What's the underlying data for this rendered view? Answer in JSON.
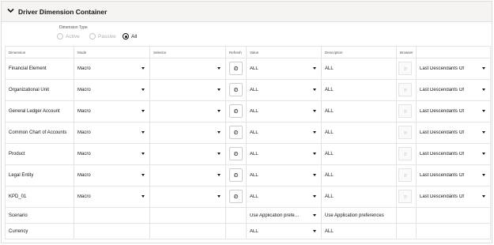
{
  "panel": {
    "title": "Driver Dimension Container"
  },
  "dimension_type": {
    "label": "Dimension Type",
    "options": [
      {
        "label": "Active",
        "selected": false
      },
      {
        "label": "Passive",
        "selected": false
      },
      {
        "label": "All",
        "selected": true
      }
    ]
  },
  "columns": {
    "dimension": "Dimension",
    "mode": "Mode",
    "selector": "Selector",
    "refresh": "Refresh",
    "value": "Value",
    "description": "Description",
    "browser": "Browser"
  },
  "rows": [
    {
      "dimension": "Financial Element",
      "mode": "Macro",
      "selector": "",
      "value": "ALL",
      "description": "ALL",
      "hierarchy": "Last Descendants Of"
    },
    {
      "dimension": "Organizational Unit",
      "mode": "Macro",
      "selector": "",
      "value": "ALL",
      "description": "ALL",
      "hierarchy": "Last Descendants Of"
    },
    {
      "dimension": "General Ledger Account",
      "mode": "Macro",
      "selector": "",
      "value": "ALL",
      "description": "ALL",
      "hierarchy": "Last Descendants Of"
    },
    {
      "dimension": "Common Chart of Accounts",
      "mode": "Macro",
      "selector": "",
      "value": "ALL",
      "description": "ALL",
      "hierarchy": "Last Descendants Of"
    },
    {
      "dimension": "Product",
      "mode": "Macro",
      "selector": "",
      "value": "ALL",
      "description": "ALL",
      "hierarchy": "Last Descendants Of"
    },
    {
      "dimension": "Legal Entity",
      "mode": "Macro",
      "selector": "",
      "value": "ALL",
      "description": "ALL",
      "hierarchy": "Last Descendants Of"
    },
    {
      "dimension": "KPD_01",
      "mode": "Macro",
      "selector": "",
      "value": "ALL",
      "description": "ALL",
      "hierarchy": "Last Descendants Of"
    }
  ],
  "extra_rows": [
    {
      "dimension": "Scenario",
      "value": "Use Application prefe…",
      "description": "Use Application preferences"
    },
    {
      "dimension": "Currency",
      "value": "ALL",
      "description": "ALL"
    }
  ]
}
